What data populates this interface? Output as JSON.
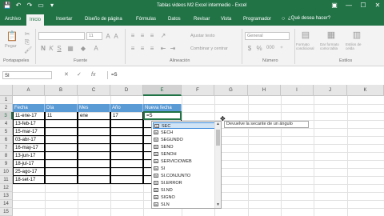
{
  "window": {
    "title": "Tablas videos M2 Excel intermedio - Excel",
    "quick_access": [
      "💾",
      "↶",
      "↷",
      "▭",
      "▾"
    ],
    "controls": [
      "▣",
      "—",
      "☐",
      "✕"
    ]
  },
  "ribbon_tabs": [
    "Archivo",
    "Inicio",
    "Insertar",
    "Diseño de página",
    "Fórmulas",
    "Datos",
    "Revisar",
    "Vista",
    "Programador"
  ],
  "tell_me": "¿Qué desea hacer?",
  "ribbon": {
    "paste_label": "Pegar",
    "font_size": "11",
    "number_format": "General",
    "currency_symbol": "$",
    "percent_symbol": "%",
    "thousands_symbol": "000",
    "wrap_text": "Ajustar texto",
    "merge_center": "Combinar y centrar",
    "conditional_format": "Formato condicional",
    "format_as_table": "Dar formato como tabla",
    "cell_styles": "Estilos de celda",
    "groups": [
      "Portapapeles",
      "Fuente",
      "Alineación",
      "Número",
      "Estilos"
    ]
  },
  "formula_bar": {
    "name_box": "SI",
    "cancel": "✕",
    "enter": "✓",
    "fx": "fx",
    "content": "=S"
  },
  "columns": [
    "A",
    "B",
    "C",
    "D",
    "E",
    "F",
    "G",
    "H",
    "I",
    "J",
    "K"
  ],
  "rows": [
    "1",
    "2",
    "3",
    "4",
    "5",
    "6",
    "7",
    "8",
    "9",
    "10",
    "11",
    "12",
    "13",
    "14",
    "15"
  ],
  "table": {
    "headers": [
      "Fecha",
      "Día",
      "Mes",
      "Año",
      "Nueva fecha"
    ],
    "rows": [
      [
        "11-ene-17",
        "11",
        "ene",
        "17",
        "=S"
      ],
      [
        "13-feb-17",
        "",
        "",
        "",
        ""
      ],
      [
        "15-mar-17",
        "",
        "",
        "",
        ""
      ],
      [
        "03-abr-17",
        "",
        "",
        "",
        ""
      ],
      [
        "16-may-17",
        "",
        "",
        "",
        ""
      ],
      [
        "13-jun-17",
        "",
        "",
        "",
        ""
      ],
      [
        "18-jul-17",
        "",
        "",
        "",
        ""
      ],
      [
        "25-ago-17",
        "",
        "",
        "",
        ""
      ],
      [
        "18-set-17",
        "",
        "",
        "",
        ""
      ]
    ]
  },
  "autocomplete": {
    "items": [
      "SEC",
      "SECH",
      "SEGUNDO",
      "SENO",
      "SENOH",
      "SERVICIOWEB",
      "SI",
      "SI.CONJUNTO",
      "SI.ERROR",
      "SI.ND",
      "SIGNO",
      "SLN"
    ],
    "selected_index": 0,
    "tooltip": "Devuelve la secante de un ángulo"
  },
  "colors": {
    "accent": "#217346",
    "table_header": "#5b9bd5",
    "selection": "#cfe3f5"
  }
}
